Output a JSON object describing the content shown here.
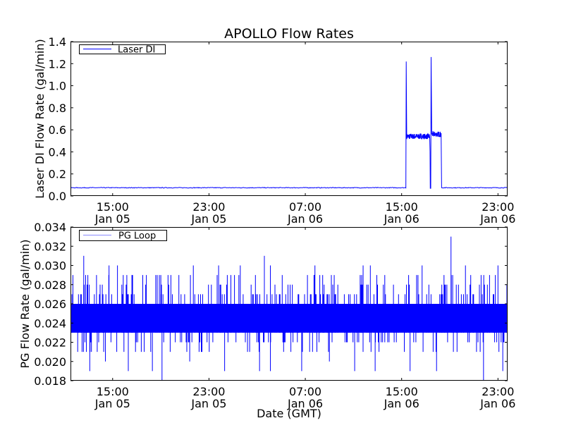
{
  "title": "APOLLO Flow Rates",
  "chart_data": [
    {
      "type": "line",
      "title": "APOLLO Flow Rates",
      "xlabel": "",
      "ylabel": "Laser DI Flow Rate (gal/min)",
      "x_units": "hours since Jan 05 00:00 GMT",
      "xlim": [
        11.5,
        47.8
      ],
      "ylim": [
        0,
        1.4
      ],
      "yticks": [
        "0.0",
        "0.2",
        "0.4",
        "0.6",
        "0.8",
        "1.0",
        "1.2",
        "1.4"
      ],
      "ytick_values": [
        0,
        0.2,
        0.4,
        0.6,
        0.8,
        1.0,
        1.2,
        1.4
      ],
      "xticks": [
        {
          "value": 15,
          "time": "15:00",
          "date": "Jan 05"
        },
        {
          "value": 23,
          "time": "23:00",
          "date": "Jan 05"
        },
        {
          "value": 31,
          "time": "07:00",
          "date": "Jan 06"
        },
        {
          "value": 39,
          "time": "15:00",
          "date": "Jan 06"
        },
        {
          "value": 47,
          "time": "23:00",
          "date": "Jan 06"
        }
      ],
      "legend": {
        "label": "Laser DI",
        "placement": "top-left"
      },
      "color": "#0000ff",
      "series": [
        {
          "name": "Laser DI",
          "points": [
            [
              11.5,
              0.075
            ],
            [
              39.35,
              0.075
            ],
            [
              39.38,
              1.22
            ],
            [
              39.42,
              0.55
            ],
            [
              41.33,
              0.54
            ],
            [
              41.36,
              0.4
            ],
            [
              41.38,
              0.07
            ],
            [
              41.42,
              0.07
            ],
            [
              41.45,
              1.26
            ],
            [
              41.5,
              0.56
            ],
            [
              42.28,
              0.57
            ],
            [
              42.32,
              0.075
            ],
            [
              47.8,
              0.075
            ]
          ],
          "plateaus": [
            {
              "from": 39.42,
              "to": 41.33,
              "mean": 0.54,
              "jitter": 0.025
            },
            {
              "from": 41.5,
              "to": 42.28,
              "mean": 0.56,
              "jitter": 0.025
            }
          ]
        }
      ]
    },
    {
      "type": "line",
      "xlabel": "Date (GMT)",
      "ylabel": "PG Flow Rate (gal/min)",
      "x_units": "hours since Jan 05 00:00 GMT",
      "xlim": [
        11.5,
        47.8
      ],
      "ylim": [
        0.018,
        0.034
      ],
      "yticks": [
        "0.018",
        "0.020",
        "0.022",
        "0.024",
        "0.026",
        "0.028",
        "0.030",
        "0.032",
        "0.034"
      ],
      "ytick_values": [
        0.018,
        0.02,
        0.022,
        0.024,
        0.026,
        0.028,
        0.03,
        0.032,
        0.034
      ],
      "xticks": [
        {
          "value": 15,
          "time": "15:00",
          "date": "Jan 05"
        },
        {
          "value": 23,
          "time": "23:00",
          "date": "Jan 05"
        },
        {
          "value": 31,
          "time": "07:00",
          "date": "Jan 06"
        },
        {
          "value": 39,
          "time": "15:00",
          "date": "Jan 06"
        },
        {
          "value": 47,
          "time": "23:00",
          "date": "Jan 06"
        }
      ],
      "legend": {
        "label": "PG Loop",
        "placement": "top-left"
      },
      "color": "#0000ff",
      "series": [
        {
          "name": "PG Loop",
          "typical_band": [
            0.023,
            0.026
          ],
          "spikes_up": [
            [
              11.7,
              0.029
            ],
            [
              12.6,
              0.031
            ],
            [
              14.7,
              0.03
            ],
            [
              15.4,
              0.03
            ],
            [
              17.8,
              0.029
            ],
            [
              19.0,
              0.029
            ],
            [
              19.6,
              0.029
            ],
            [
              20.5,
              0.029
            ],
            [
              21.7,
              0.03
            ],
            [
              23.8,
              0.03
            ],
            [
              25.6,
              0.03
            ],
            [
              27.6,
              0.031
            ],
            [
              28.1,
              0.03
            ],
            [
              31.8,
              0.03
            ],
            [
              33.4,
              0.029
            ],
            [
              35.8,
              0.03
            ],
            [
              36.4,
              0.03
            ],
            [
              37.6,
              0.029
            ],
            [
              40.7,
              0.03
            ],
            [
              43.1,
              0.033
            ],
            [
              44.3,
              0.03
            ],
            [
              45.6,
              0.029
            ],
            [
              47.0,
              0.03
            ]
          ],
          "spikes_down": [
            [
              13.1,
              0.019
            ],
            [
              14.4,
              0.02
            ],
            [
              16.3,
              0.019
            ],
            [
              18.3,
              0.019
            ],
            [
              19.1,
              0.018
            ],
            [
              21.4,
              0.02
            ],
            [
              24.3,
              0.019
            ],
            [
              27.2,
              0.019
            ],
            [
              28.1,
              0.019
            ],
            [
              30.7,
              0.019
            ],
            [
              33.0,
              0.02
            ],
            [
              35.1,
              0.019
            ],
            [
              36.8,
              0.019
            ],
            [
              39.7,
              0.019
            ],
            [
              41.9,
              0.019
            ],
            [
              45.8,
              0.018
            ],
            [
              47.4,
              0.019
            ]
          ]
        }
      ]
    }
  ]
}
